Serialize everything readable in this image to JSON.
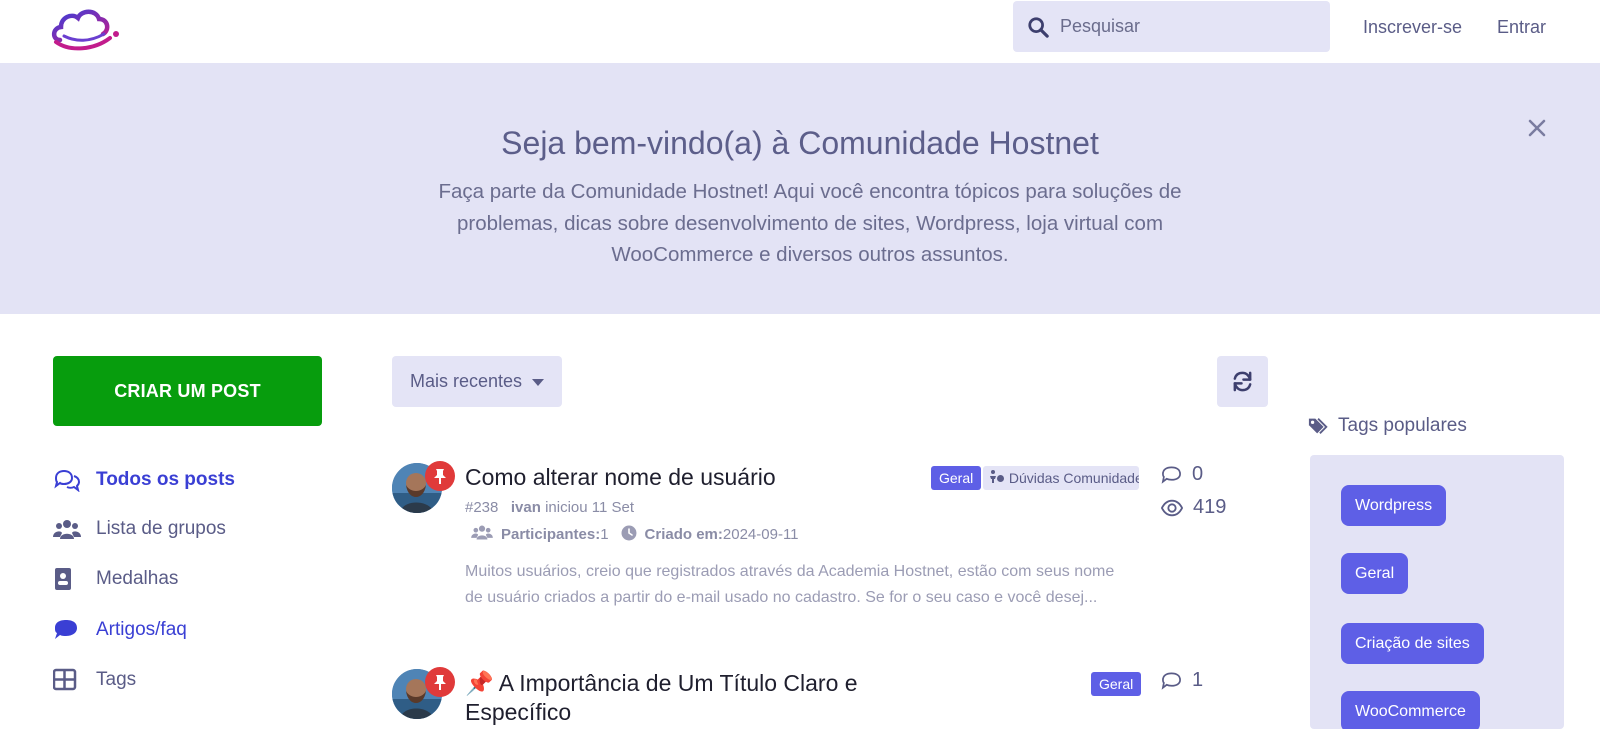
{
  "header": {
    "search_placeholder": "Pesquisar",
    "signup_label": "Inscrever-se",
    "login_label": "Entrar"
  },
  "banner": {
    "title": "Seja bem-vindo(a) à Comunidade Hostnet",
    "text": "Faça parte da Comunidade Hostnet! Aqui você encontra tópicos para soluções de problemas, dicas sobre desenvolvimento de sites, Wordpress, loja virtual com WooCommerce e diversos outros assuntos."
  },
  "sidebar": {
    "create_post_label": "CRIAR UM POST",
    "items": [
      {
        "label": "Todos os posts",
        "icon": "chat-bubbles-icon"
      },
      {
        "label": "Lista de grupos",
        "icon": "users-icon"
      },
      {
        "label": "Medalhas",
        "icon": "badge-icon"
      },
      {
        "label": "Artigos/faq",
        "icon": "comment-icon"
      },
      {
        "label": "Tags",
        "icon": "grid-icon"
      }
    ]
  },
  "main": {
    "sort_label": "Mais recentes",
    "topics": [
      {
        "title": "Como alterar nome de usuário",
        "tags": [
          "Geral",
          "Dúvidas Comunidade"
        ],
        "number": "#238",
        "author": "ivan",
        "started": "iniciou 11 Set",
        "participants_label": "Participantes:",
        "participants": "1",
        "created_label": "Criado em:",
        "created": "2024-09-11",
        "excerpt": "Muitos usuários, creio que registrados através da Academia Hostnet, estão com seus nome de usuário criados a partir do e-mail usado no cadastro. Se for o seu caso e você desej...",
        "replies": "0",
        "views": "419"
      },
      {
        "emoji": "📌",
        "title": "A Importância de Um Título Claro e Específico",
        "tags": [
          "Geral"
        ],
        "replies": "1"
      }
    ]
  },
  "right_sidebar": {
    "title": "Tags populares",
    "tags": [
      "Wordpress",
      "Geral",
      "Criação de sites",
      "WooCommerce"
    ]
  },
  "colors": {
    "accent": "#5e5fe6",
    "banner_bg": "#e3e3f5",
    "create_button": "#079d0d",
    "pin_badge": "#e03a3a"
  }
}
